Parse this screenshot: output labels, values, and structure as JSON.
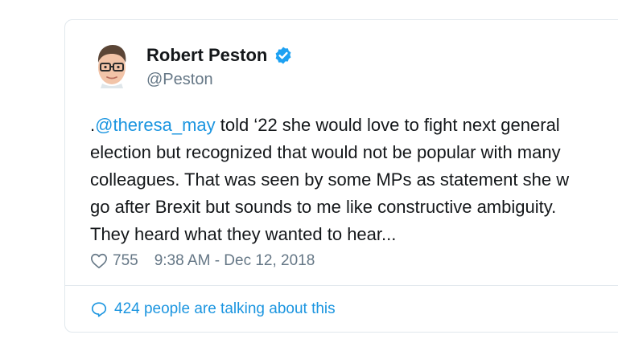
{
  "tweet": {
    "author_name": "Robert Peston",
    "handle": "@Peston",
    "text_lines": [
      {
        "prefix": ".",
        "mention": "@theresa_may",
        "rest": " told ‘22 she would love to fight next general"
      },
      "election but recognized that would not be popular with many",
      "colleagues. That was seen by some MPs as statement she w",
      "go after Brexit but sounds to me like constructive ambiguity.",
      "They heard what they wanted to hear..."
    ],
    "like_count": "755",
    "timestamp": "9:38 AM - Dec 12, 2018",
    "talking_label": "424 people are talking about this"
  },
  "icons": {
    "verified": "verified-badge-icon",
    "like": "heart-icon",
    "talking": "speech-bubble-icon"
  },
  "colors": {
    "link_blue": "#1b95e0",
    "muted_gray": "#657786",
    "text_dark": "#14171a",
    "verified_blue": "#1da1f2",
    "border": "#e1e8ed"
  }
}
